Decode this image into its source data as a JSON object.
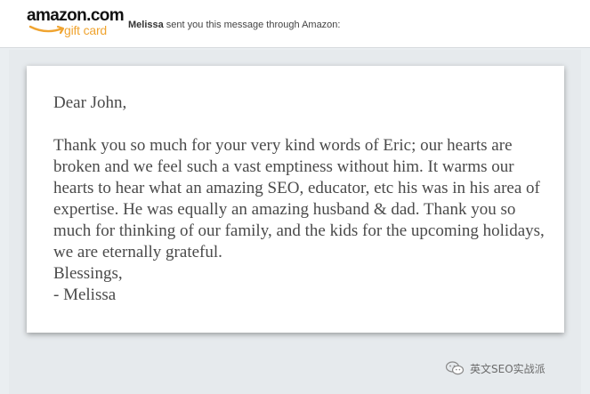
{
  "header": {
    "logo_text": "amazon.com",
    "logo_subtext": "gift card",
    "sender_name": "Melissa",
    "sender_suffix": " sent you this message through Amazon:"
  },
  "message": {
    "greeting": "Dear John,",
    "body": "Thank you so much for your very kind words of Eric; our hearts are broken and we feel such a vast emptiness without him. It warms our hearts to hear what an amazing SEO, educator, etc his was in his area of expertise. He was equally an amazing husband & dad. Thank you so much for thinking of our family, and the kids for the upcoming holidays, we are eternally grateful.",
    "closing": "Blessings,",
    "signature": "- Melissa"
  },
  "watermark": {
    "text": "英文SEO实战派",
    "icon": "wechat-icon"
  },
  "colors": {
    "logo_accent": "#f0a430",
    "background": "#eaeef1",
    "letter_text": "#4a4a4a"
  }
}
